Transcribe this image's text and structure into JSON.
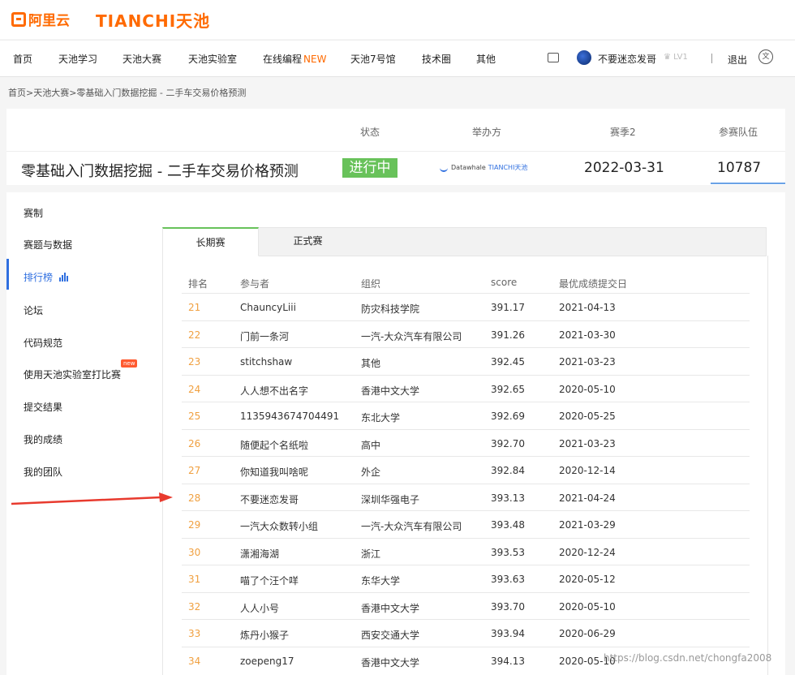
{
  "logo": {
    "aliyun": "阿里云",
    "tianchi": "TIANCHI天池"
  },
  "nav": {
    "items": [
      "首页",
      "天池学习",
      "天池大赛",
      "天池实验室",
      "在线编程",
      "天池7号馆",
      "技术圈",
      "其他"
    ],
    "new_badge": "NEW",
    "user_name": "不要迷恋发哥",
    "level": "LV1",
    "divider": "|",
    "logout": "退出",
    "lang_glyph": "文"
  },
  "breadcrumb": "首页>天池大赛>零基础入门数据挖掘 - 二手车交易价格预测",
  "competition": {
    "labels": {
      "status": "状态",
      "organizer": "举办方",
      "season": "赛季2",
      "teams": "参赛队伍"
    },
    "title": "零基础入门数据挖掘 - 二手车交易价格预测",
    "status": "进行中",
    "organizer_name": "Datawhale",
    "organizer_partner": "TIANCHI天池",
    "season_date": "2022-03-31",
    "team_count": "10787"
  },
  "sidebar": {
    "items": [
      "赛制",
      "赛题与数据",
      "排行榜",
      "论坛",
      "代码规范",
      "使用天池实验室打比赛",
      "提交结果",
      "我的成绩",
      "我的团队"
    ],
    "new_badge": "new"
  },
  "tabs": [
    "长期赛",
    "正式赛"
  ],
  "table": {
    "headers": [
      "排名",
      "参与者",
      "组织",
      "score",
      "最优成绩提交日"
    ],
    "rows": [
      [
        "21",
        "ChauncyLiii",
        "防灾科技学院",
        "391.17",
        "2021-04-13"
      ],
      [
        "22",
        "门前一条河",
        "一汽-大众汽车有限公司",
        "391.26",
        "2021-03-30"
      ],
      [
        "23",
        "stitchshaw",
        "其他",
        "392.45",
        "2021-03-23"
      ],
      [
        "24",
        "人人想不出名字",
        "香港中文大学",
        "392.65",
        "2020-05-10"
      ],
      [
        "25",
        "1135943674704491",
        "东北大学",
        "392.69",
        "2020-05-25"
      ],
      [
        "26",
        "随便起个名纸啦",
        "高中",
        "392.70",
        "2021-03-23"
      ],
      [
        "27",
        "你知道我叫啥呢",
        "外企",
        "392.84",
        "2020-12-14"
      ],
      [
        "28",
        "不要迷恋发哥",
        "深圳华强电子",
        "393.13",
        "2021-04-24"
      ],
      [
        "29",
        "一汽大众数转小组",
        "一汽-大众汽车有限公司",
        "393.48",
        "2021-03-29"
      ],
      [
        "30",
        "潇湘海湖",
        "浙江",
        "393.53",
        "2020-12-24"
      ],
      [
        "31",
        "喵了个汪个咩",
        "东华大学",
        "393.63",
        "2020-05-12"
      ],
      [
        "32",
        "人人小号",
        "香港中文大学",
        "393.70",
        "2020-05-10"
      ],
      [
        "33",
        "炼丹小猴子",
        "西安交通大学",
        "393.94",
        "2020-06-29"
      ],
      [
        "34",
        "zoepeng17",
        "香港中文大学",
        "394.13",
        "2020-05-10"
      ]
    ]
  },
  "watermark": "https://blog.csdn.net/chongfa2008",
  "colors": {
    "brand": "#ff6a00",
    "accent": "#2f6fe0",
    "status_green": "#68c25a",
    "rank": "#f0a040",
    "arrow": "#e83a2e"
  }
}
